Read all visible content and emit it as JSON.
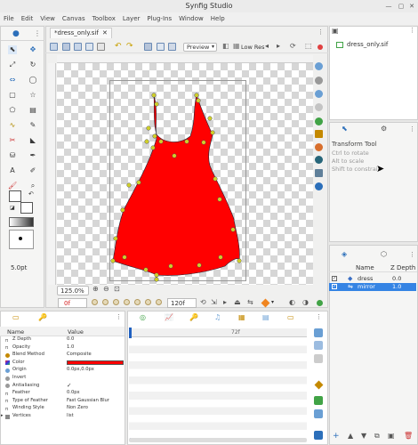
{
  "window": {
    "title": "Synfig Studio"
  },
  "menu": [
    "File",
    "Edit",
    "View",
    "Canvas",
    "Toolbox",
    "Layer",
    "Plug-Ins",
    "Window",
    "Help"
  ],
  "document": {
    "tab_label": "*dress_only.sif",
    "render_mode": "Preview",
    "quality": "Low Res",
    "zoom": "125.0%",
    "current_frame": "0f",
    "end_frame": "120f"
  },
  "toolbox": {
    "brush_size": "5.0pt"
  },
  "canvas_browser": {
    "file": "dress_only.sif"
  },
  "tool_options": {
    "title": "Transform Tool",
    "hints": [
      "Ctrl to rotate",
      "Alt to scale",
      "Shift to constrain"
    ]
  },
  "layers": {
    "headers": {
      "name": "Name",
      "depth": "Z Depth"
    },
    "rows": [
      {
        "name": "dress",
        "depth": "0.0",
        "checked": true,
        "selected": false
      },
      {
        "name": "mirror",
        "depth": "1.0",
        "checked": true,
        "selected": true
      }
    ]
  },
  "params": {
    "headers": {
      "name": "Name",
      "value": "Value"
    },
    "rows": [
      {
        "name": "Z Depth",
        "value": "0.0",
        "icon": "pi"
      },
      {
        "name": "Opacity",
        "value": "1.0",
        "icon": "pi"
      },
      {
        "name": "Blend Method",
        "value": "Composite",
        "icon": "blend"
      },
      {
        "name": "Color",
        "value": "",
        "icon": "color"
      },
      {
        "name": "Origin",
        "value": "0.0px,0.0px",
        "icon": "origin"
      },
      {
        "name": "Invert",
        "value": "",
        "icon": "toggle"
      },
      {
        "name": "Antialiasing",
        "value": "✓",
        "icon": "toggle"
      },
      {
        "name": "Feather",
        "value": "0.0px",
        "icon": "pi"
      },
      {
        "name": "Type of Feather",
        "value": "Fast Gaussian Blur",
        "icon": "pi"
      },
      {
        "name": "Winding Style",
        "value": "Non Zero",
        "icon": "pi"
      },
      {
        "name": "Vertices",
        "value": "list",
        "icon": "list"
      }
    ]
  },
  "timetrack": {
    "marker": "72f"
  },
  "colors": {
    "dress_fill": "#ff0000",
    "selection": "#3584e4",
    "accent_green": "#22dd22",
    "outline_color": "#ff0000"
  }
}
